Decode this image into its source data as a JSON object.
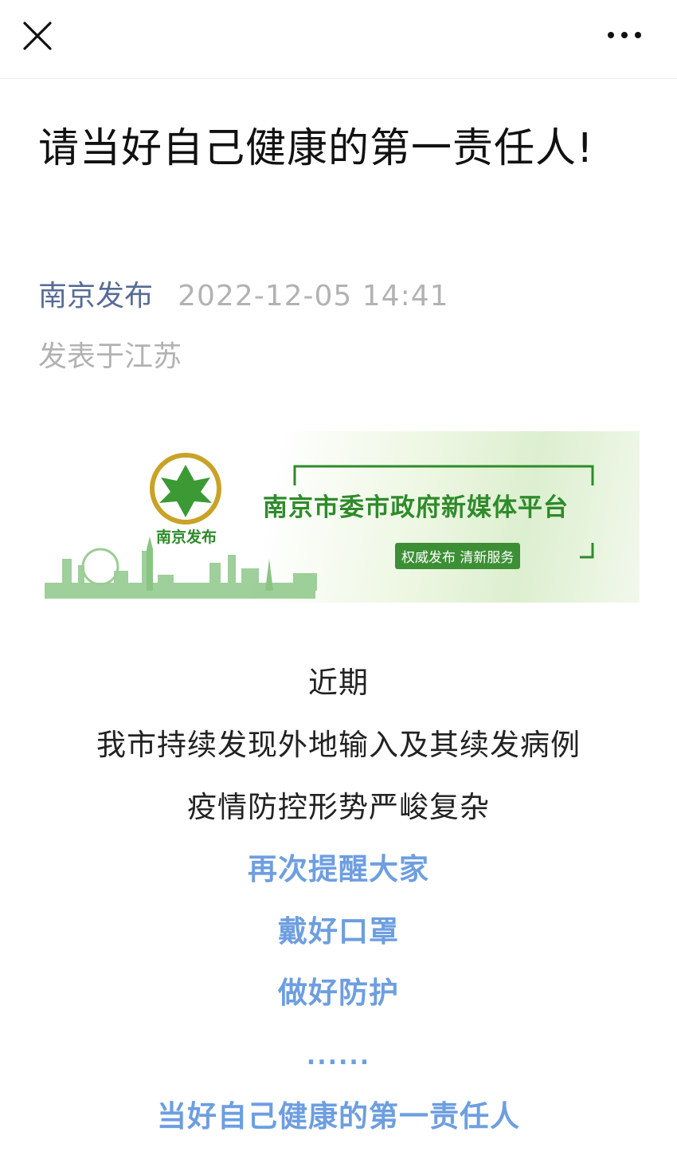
{
  "nav": {
    "close_icon": "close-icon",
    "more_icon": "more-icon"
  },
  "article": {
    "title": "请当好自己健康的第一责任人!",
    "account_name": "南京发布",
    "publish_time": "2022-12-05 14:41",
    "location": "发表于江苏"
  },
  "banner": {
    "logo_text": "南京发布",
    "headline": "南京市委市政府新媒体平台",
    "tagline": "权威发布  清新服务",
    "colors": {
      "green": "#2e8b2a",
      "light_green": "#dcefcf"
    }
  },
  "content": {
    "lines": [
      "近期",
      "我市持续发现外地输入及其续发病例",
      "疫情防控形势严峻复杂"
    ],
    "highlight_lines": [
      "再次提醒大家",
      "戴好口罩",
      "做好防护"
    ],
    "ellipsis": "......",
    "closing_line": "当好自己健康的第一责任人"
  },
  "colors": {
    "link": "#576b95",
    "meta": "#b2b2b2",
    "highlight": "#6d9ee0"
  }
}
